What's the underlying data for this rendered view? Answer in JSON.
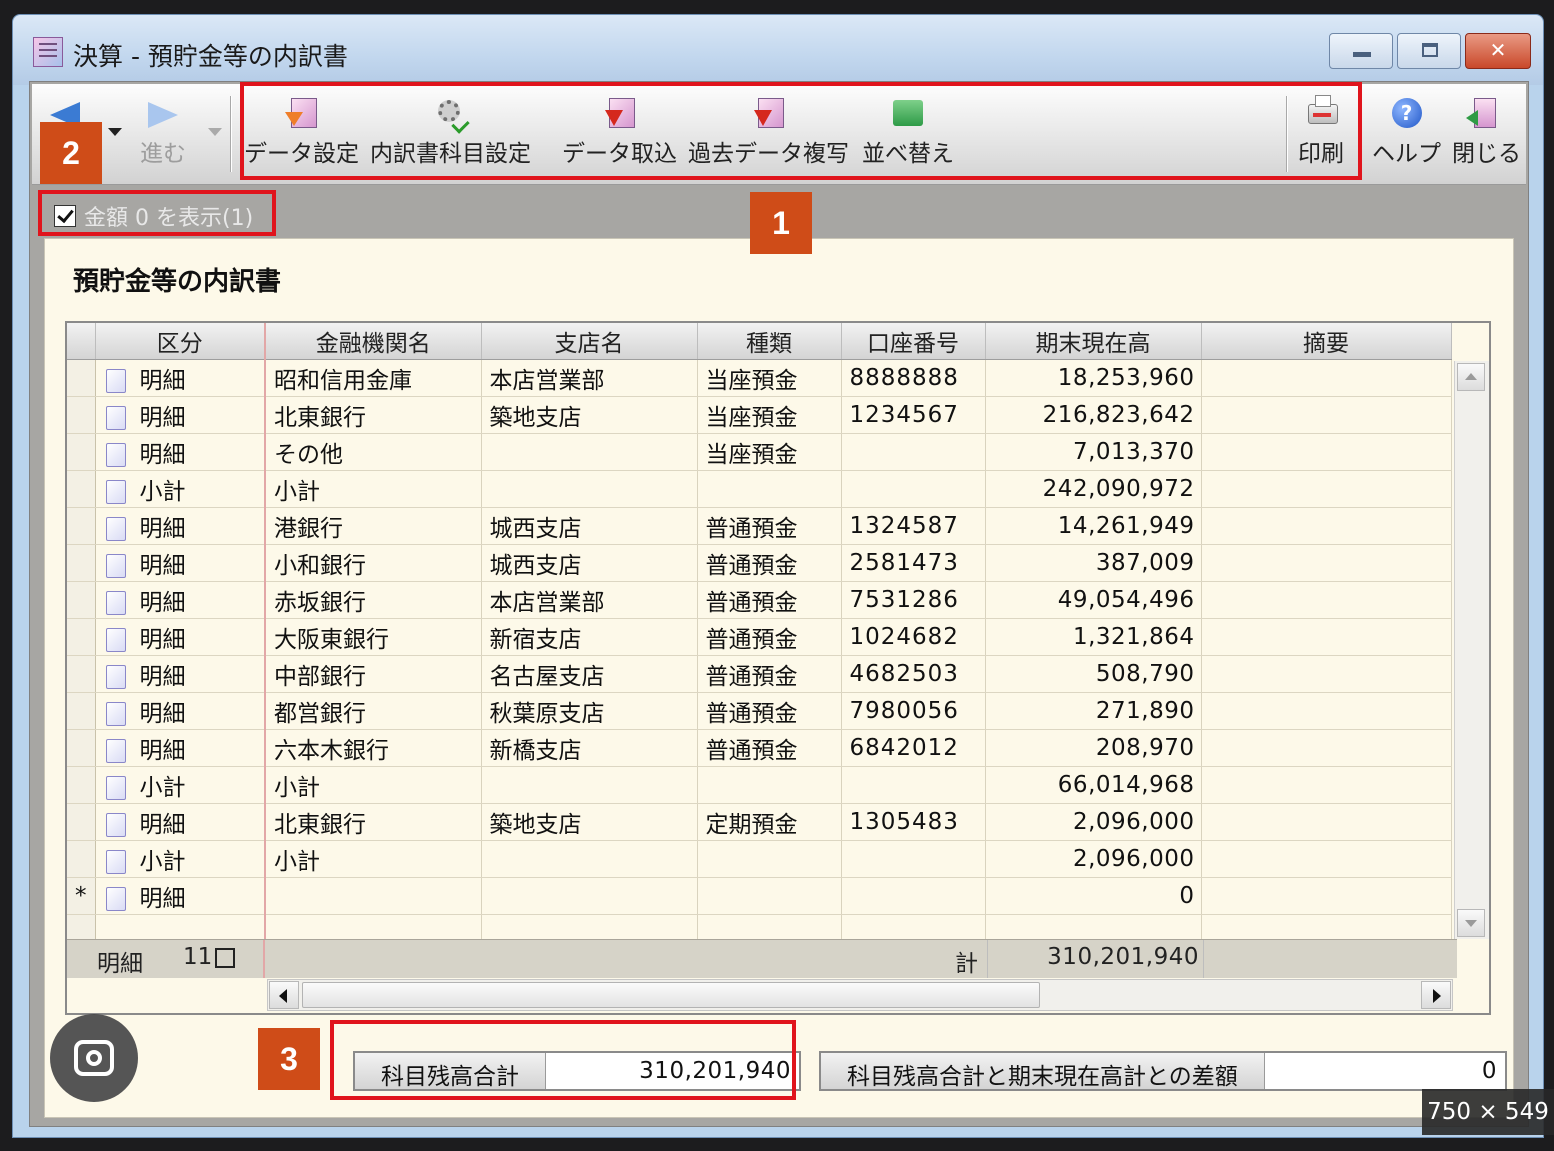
{
  "window": {
    "title": "決算 - 預貯金等の内訳書",
    "controls": {
      "minimize": "minimize-icon",
      "maximize": "maximize-icon",
      "close": "close-icon"
    }
  },
  "toolbar": {
    "forward_label": "進む",
    "items": [
      {
        "label": "データ設定",
        "icon": "data-settings-icon"
      },
      {
        "label": "内訳書科目設定",
        "icon": "subject-settings-icon"
      },
      {
        "label": "データ取込",
        "icon": "data-import-icon"
      },
      {
        "label": "過去データ複写",
        "icon": "copy-past-data-icon"
      },
      {
        "label": "並べ替え",
        "icon": "sort-icon"
      },
      {
        "label": "印刷",
        "icon": "printer-icon"
      },
      {
        "label": "ヘルプ",
        "icon": "help-icon"
      },
      {
        "label": "閉じる",
        "icon": "exit-icon"
      }
    ]
  },
  "options": {
    "show_zero_amount_label": "金額 0 を表示(1)",
    "show_zero_amount_checked": true
  },
  "panel": {
    "title": "預貯金等の内訳書"
  },
  "table": {
    "columns": [
      "区分",
      "金融機関名",
      "支店名",
      "種類",
      "口座番号",
      "期末現在高",
      "摘要"
    ],
    "rows": [
      {
        "marker": "",
        "kubun": "明細",
        "bank": "昭和信用金庫",
        "branch": "本店営業部",
        "type": "当座預金",
        "account": "8888888",
        "amount": "18,253,960",
        "note": ""
      },
      {
        "marker": "",
        "kubun": "明細",
        "bank": "北東銀行",
        "branch": "築地支店",
        "type": "当座預金",
        "account": "1234567",
        "amount": "216,823,642",
        "note": ""
      },
      {
        "marker": "",
        "kubun": "明細",
        "bank": "その他",
        "branch": "",
        "type": "当座預金",
        "account": "",
        "amount": "7,013,370",
        "note": ""
      },
      {
        "marker": "",
        "kubun": "小計",
        "bank": "小計",
        "branch": "",
        "type": "",
        "account": "",
        "amount": "242,090,972",
        "note": ""
      },
      {
        "marker": "",
        "kubun": "明細",
        "bank": "港銀行",
        "branch": "城西支店",
        "type": "普通預金",
        "account": "1324587",
        "amount": "14,261,949",
        "note": ""
      },
      {
        "marker": "",
        "kubun": "明細",
        "bank": "小和銀行",
        "branch": "城西支店",
        "type": "普通預金",
        "account": "2581473",
        "amount": "387,009",
        "note": ""
      },
      {
        "marker": "",
        "kubun": "明細",
        "bank": "赤坂銀行",
        "branch": "本店営業部",
        "type": "普通預金",
        "account": "7531286",
        "amount": "49,054,496",
        "note": ""
      },
      {
        "marker": "",
        "kubun": "明細",
        "bank": "大阪東銀行",
        "branch": "新宿支店",
        "type": "普通預金",
        "account": "1024682",
        "amount": "1,321,864",
        "note": ""
      },
      {
        "marker": "",
        "kubun": "明細",
        "bank": "中部銀行",
        "branch": "名古屋支店",
        "type": "普通預金",
        "account": "4682503",
        "amount": "508,790",
        "note": ""
      },
      {
        "marker": "",
        "kubun": "明細",
        "bank": "都営銀行",
        "branch": "秋葉原支店",
        "type": "普通預金",
        "account": "7980056",
        "amount": "271,890",
        "note": ""
      },
      {
        "marker": "",
        "kubun": "明細",
        "bank": "六本木銀行",
        "branch": "新橋支店",
        "type": "普通預金",
        "account": "6842012",
        "amount": "208,970",
        "note": ""
      },
      {
        "marker": "",
        "kubun": "小計",
        "bank": "小計",
        "branch": "",
        "type": "",
        "account": "",
        "amount": "66,014,968",
        "note": ""
      },
      {
        "marker": "",
        "kubun": "明細",
        "bank": "北東銀行",
        "branch": "築地支店",
        "type": "定期預金",
        "account": "1305483",
        "amount": "2,096,000",
        "note": ""
      },
      {
        "marker": "",
        "kubun": "小計",
        "bank": "小計",
        "branch": "",
        "type": "",
        "account": "",
        "amount": "2,096,000",
        "note": ""
      },
      {
        "marker": "*",
        "kubun": "明細",
        "bank": "",
        "branch": "",
        "type": "",
        "account": "",
        "amount": "0",
        "note": ""
      }
    ],
    "footer": {
      "count_label": "明細",
      "count_value": "11",
      "total_label": "計",
      "total_value": "310,201,940"
    }
  },
  "summary": {
    "subject_total_label": "科目残高合計",
    "subject_total_value": "310,201,940",
    "difference_label": "科目残高合計と期末現在高計との差額",
    "difference_value": "0"
  },
  "annotations": {
    "badge1": "1",
    "badge2": "2",
    "badge3": "3",
    "highlight_color": "#e0141c",
    "badge_color": "#cf4c18"
  },
  "overlay": {
    "dimensions": "750 × 549",
    "lens_icon": "lens-search-icon"
  }
}
